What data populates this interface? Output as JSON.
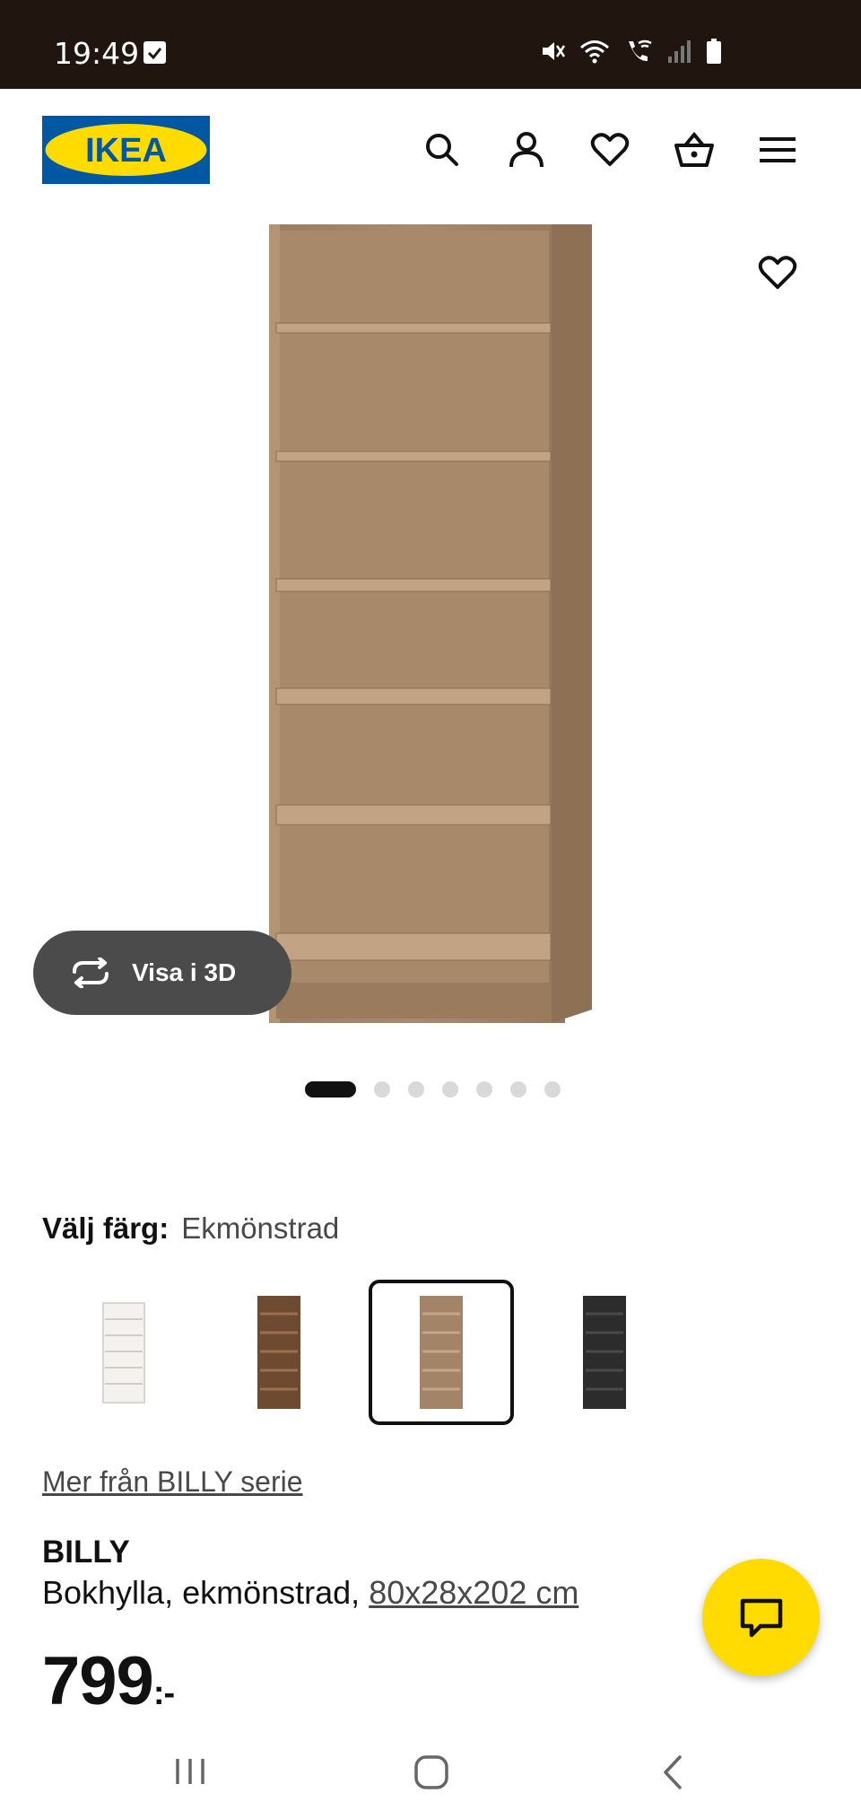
{
  "status_bar": {
    "time": "19:49",
    "icons": [
      "checkbox-notification-icon",
      "mute-icon",
      "wifi-icon",
      "wifi-call-icon",
      "signal-icon",
      "battery-icon"
    ]
  },
  "header": {
    "logo_text": "IKEA",
    "brand_colors": {
      "blue": "#0058a3",
      "yellow": "#ffdb00"
    },
    "icons": [
      "search-icon",
      "user-icon",
      "heart-icon",
      "basket-icon",
      "menu-icon"
    ]
  },
  "gallery": {
    "view_3d_label": "Visa i 3D",
    "dot_count": 7,
    "active_dot": 1
  },
  "color_selector": {
    "label": "Välj färg:",
    "selected_value": "Ekmönstrad",
    "swatches": [
      {
        "color": "#f3f2ee",
        "selected": false
      },
      {
        "color": "#6e4a30",
        "selected": false
      },
      {
        "color": "#a48466",
        "selected": true
      },
      {
        "color": "#2c2c2c",
        "selected": false
      }
    ]
  },
  "product": {
    "series_link": "Mer från BILLY serie",
    "name": "BILLY",
    "description": "Bokhylla, ekmönstrad,",
    "size": "80x28x202 cm",
    "price": "799",
    "price_suffix": ":-"
  },
  "chat": {
    "icon": "chat-icon"
  }
}
